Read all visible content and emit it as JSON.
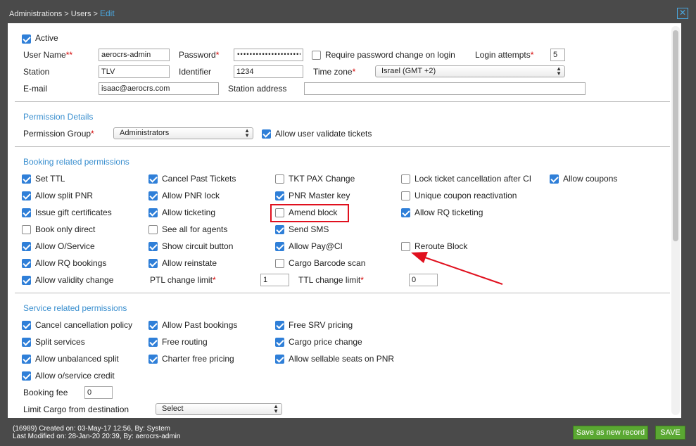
{
  "breadcrumb": {
    "path": "Administrations > Users > ",
    "current": "Edit"
  },
  "close_glyph": "✕",
  "user": {
    "active_label": "Active",
    "active": true,
    "username_label": "User Name",
    "username_req": "**",
    "username_value": "aerocrs-admin",
    "password_label": "Password",
    "password_value": "•••••••••••••••••••••••••••••",
    "require_pw_label": "Require password change on login",
    "require_pw": false,
    "login_attempts_label": "Login attempts",
    "login_attempts_value": "5",
    "station_label": "Station",
    "station_value": "TLV",
    "identifier_label": "Identifier",
    "identifier_value": "1234",
    "timezone_label": "Time zone",
    "timezone_value": "Israel (GMT +2)",
    "email_label": "E-mail",
    "email_value": "isaac@aerocrs.com",
    "station_address_label": "Station address",
    "station_address_value": ""
  },
  "required_mark": "*",
  "permission": {
    "title": "Permission Details",
    "group_label": "Permission Group",
    "group_value": "Administrators",
    "validate_label": "Allow user validate tickets",
    "validate": true
  },
  "booking": {
    "title": "Booking related permissions",
    "items": [
      {
        "label": "Set TTL",
        "checked": true
      },
      {
        "label": "Cancel Past Tickets",
        "checked": true
      },
      {
        "label": "TKT PAX Change",
        "checked": false
      },
      {
        "label": "Lock ticket cancellation after CI",
        "checked": false
      },
      {
        "label": "Allow coupons",
        "checked": true
      },
      {
        "label": "Allow split PNR",
        "checked": true
      },
      {
        "label": "Allow PNR lock",
        "checked": true
      },
      {
        "label": "PNR Master key",
        "checked": true
      },
      {
        "label": "Unique coupon reactivation",
        "checked": false
      },
      {
        "label": "Issue gift certificates",
        "checked": true
      },
      {
        "label": "Allow ticketing",
        "checked": true
      },
      {
        "label": "Amend block",
        "checked": false
      },
      {
        "label": "Allow RQ ticketing",
        "checked": true
      },
      {
        "label": "Book only direct",
        "checked": false
      },
      {
        "label": "See all for agents",
        "checked": false
      },
      {
        "label": "Send SMS",
        "checked": true
      },
      {
        "label": "Allow O/Service",
        "checked": true
      },
      {
        "label": "Show circuit button",
        "checked": true
      },
      {
        "label": "Allow Pay@CI",
        "checked": true
      },
      {
        "label": "Reroute Block",
        "checked": false
      },
      {
        "label": "Allow RQ bookings",
        "checked": true
      },
      {
        "label": "Allow reinstate",
        "checked": true
      },
      {
        "label": "Cargo Barcode scan",
        "checked": false
      },
      {
        "label": "Allow validity change",
        "checked": true
      }
    ],
    "ptl_label": "PTL change limit",
    "ptl_value": "1",
    "ttl_label": "TTL change limit",
    "ttl_value": "0"
  },
  "service": {
    "title": "Service related permissions",
    "items": [
      {
        "label": "Cancel cancellation policy",
        "checked": true
      },
      {
        "label": "Allow Past bookings",
        "checked": true
      },
      {
        "label": "Free SRV pricing",
        "checked": true
      },
      {
        "label": "Split services",
        "checked": true
      },
      {
        "label": "Free routing",
        "checked": true
      },
      {
        "label": "Cargo price change",
        "checked": true
      },
      {
        "label": "Allow unbalanced split",
        "checked": true
      },
      {
        "label": "Charter free pricing",
        "checked": true
      },
      {
        "label": "Allow sellable seats on PNR",
        "checked": true
      },
      {
        "label": "Allow o/service credit",
        "checked": true
      }
    ],
    "booking_fee_label": "Booking fee",
    "booking_fee_value": "0",
    "limit_cargo_label": "Limit Cargo from destination",
    "limit_cargo_value": "Select"
  },
  "footer": {
    "created": "(16989) Created on: 03-May-17 12:56, By: System",
    "modified": "Last Modified on: 28-Jan-20 20:39, By: aerocrs-admin"
  },
  "buttons": {
    "save_new": "Save as new record",
    "save": "SAVE"
  },
  "colors": {
    "accent": "#3a8fcf",
    "checkbox": "#2f7fd8",
    "save_button": "#5aa832",
    "highlight": "#e0101e"
  }
}
